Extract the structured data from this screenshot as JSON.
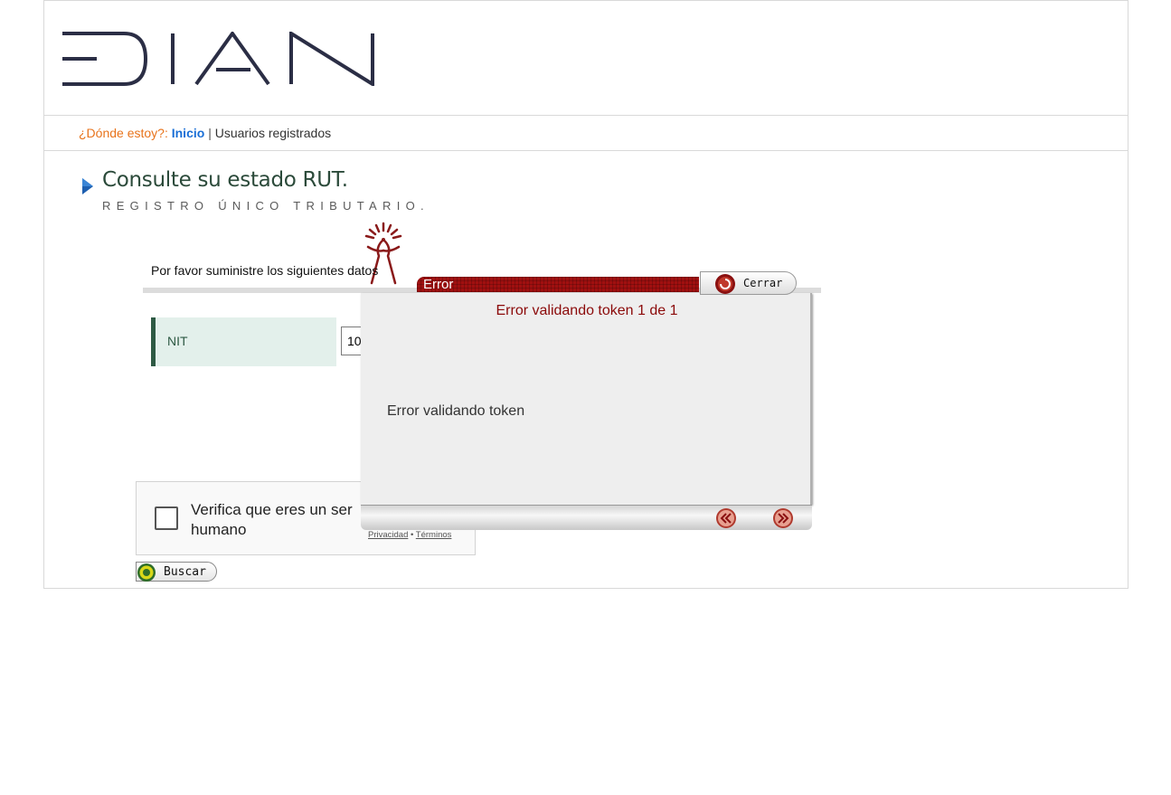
{
  "header": {
    "logo_text": "DIAN"
  },
  "breadcrumb": {
    "question": "¿Dónde estoy?:",
    "home": "Inicio",
    "separator": "|",
    "current": "Usuarios registrados"
  },
  "page": {
    "title": "Consulte su estado RUT.",
    "subtitle": "REGISTRO ÚNICO TRIBUTARIO."
  },
  "form": {
    "instructions": "Por favor suministre los siguientes datos",
    "nit_label": "NIT",
    "nit_value": "10"
  },
  "captcha": {
    "text": "Verifica que eres un ser humano",
    "privacy": "Privacidad",
    "dot": "•",
    "terms": "Términos"
  },
  "search_button": {
    "label": "Buscar"
  },
  "dialog": {
    "title": "Error",
    "close_label": "Cerrar",
    "heading": "Error validando token 1 de 1",
    "message": "Error validando token"
  },
  "colors": {
    "accent_orange": "#e8731b",
    "link_blue": "#1a6fd6",
    "dialog_red": "#a01010",
    "nit_green": "#2e5a44"
  }
}
